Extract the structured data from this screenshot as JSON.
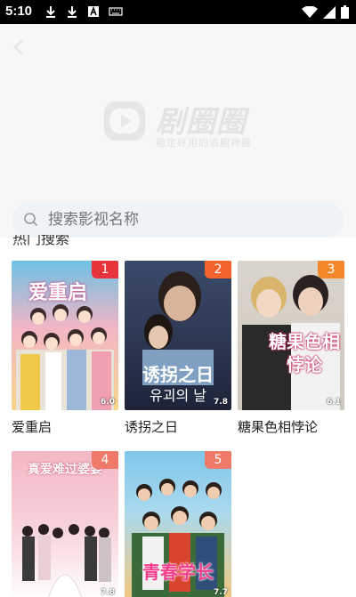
{
  "status_bar": {
    "time": "5:10"
  },
  "header": {
    "logo_name": "剧圈圈",
    "logo_slogan": "稳定好用的追剧神器"
  },
  "search": {
    "placeholder": "搜索影视名称"
  },
  "section": {
    "title": "热门搜索"
  },
  "items": [
    {
      "rank": "1",
      "title": "爱重启",
      "score": "6.0",
      "poster_text": "爱重启",
      "rank_color": "#e8333a"
    },
    {
      "rank": "2",
      "title": "诱拐之日",
      "score": "7.8",
      "poster_text": "诱拐之日",
      "poster_subtext": "유괴의 날",
      "rank_color": "#f2632e"
    },
    {
      "rank": "3",
      "title": "糖果色相悖论",
      "score": "6.1",
      "poster_text": "糖果色相悖论",
      "rank_color": "#f5882b"
    },
    {
      "rank": "4",
      "title": "",
      "score": "7.8",
      "poster_text": "真爱难过婆婆",
      "rank_color": "#f07a6a"
    },
    {
      "rank": "5",
      "title": "",
      "score": "7.7",
      "poster_text": "青春学长",
      "rank_color": "#f07a6a"
    }
  ],
  "colors": {
    "search_bg": "#eef3f8",
    "header_bg": "#f7f7f7"
  }
}
